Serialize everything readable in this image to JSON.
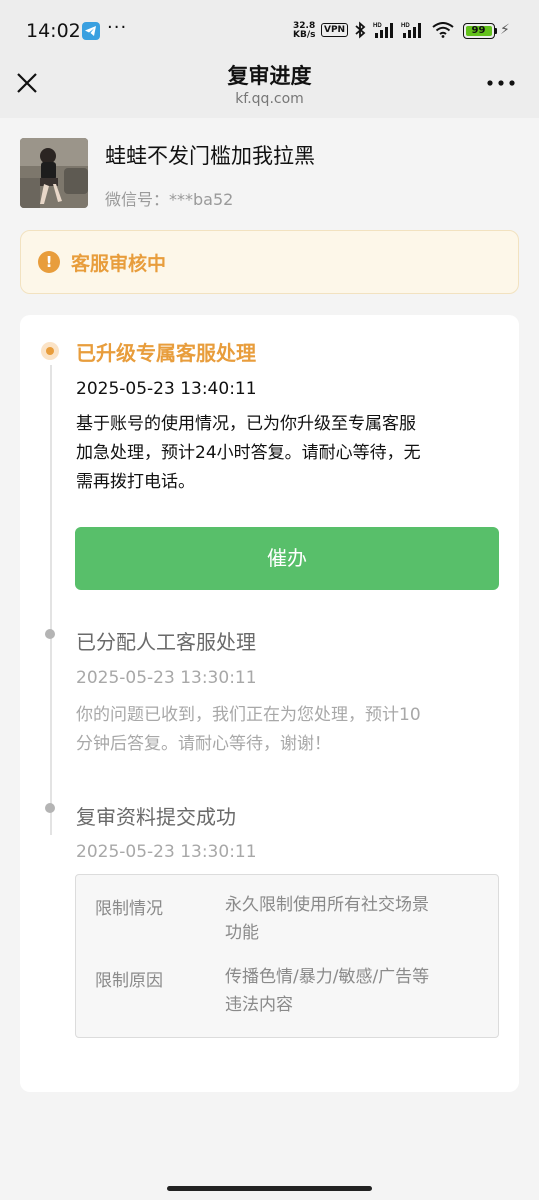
{
  "status_bar": {
    "time": "14:02",
    "more": "···",
    "net_speed_value": "32.8",
    "net_speed_unit": "KB/s",
    "vpn": "VPN",
    "battery": "99",
    "battery_color": "#63c11c"
  },
  "nav": {
    "title": "复审进度",
    "domain": "kf.qq.com",
    "close_icon": "close-icon",
    "more_icon": "more-icon"
  },
  "profile": {
    "name": "蛙蛙不发门槛加我拉黑",
    "wechat_id": "微信号：***ba52"
  },
  "banner": {
    "icon": "!",
    "text": "客服审核中",
    "accent": "#e89d3c"
  },
  "timeline": [
    {
      "title": "已升级专属客服处理",
      "time": "2025-05-23 13:40:11",
      "desc_lines": [
        "基于账号的使用情况，已为你升级至专属客服",
        "加急处理，预计24小时答复。请耐心等待，无",
        "需再拨打电话。"
      ],
      "state": "active"
    },
    {
      "title": "已分配人工客服处理",
      "time": "2025-05-23 13:30:11",
      "desc_lines": [
        "你的问题已收到，我们正在为您处理，预计10",
        "分钟后答复。请耐心等待，谢谢！"
      ],
      "state": "done"
    },
    {
      "title": "复审资料提交成功",
      "time": "2025-05-23 13:30:11",
      "state": "done"
    }
  ],
  "urge_button": {
    "label": "催办",
    "color": "#58bf6a"
  },
  "restriction": {
    "rows": [
      {
        "label": "限制情况",
        "value_lines": [
          "永久限制使用所有社交场景",
          "功能"
        ]
      },
      {
        "label": "限制原因",
        "value_lines": [
          "传播色情/暴力/敏感/广告等",
          "违法内容"
        ]
      }
    ]
  }
}
